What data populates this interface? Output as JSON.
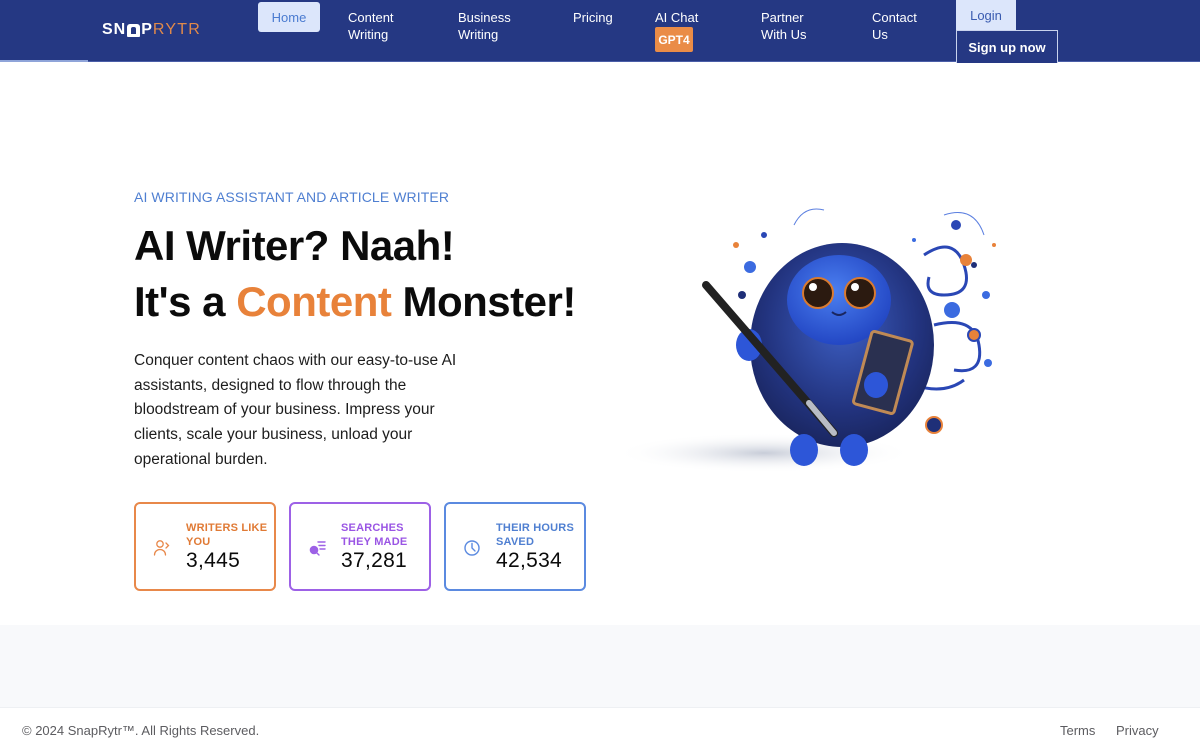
{
  "brand": {
    "name_part1": "SN",
    "name_part2": "P",
    "name_part3": "RYTR",
    "accent_color": "#e8823a",
    "primary_color": "#253883"
  },
  "nav": {
    "home": "Home",
    "content_writing": "Content Writing",
    "business_writing": "Business Writing",
    "pricing": "Pricing",
    "ai_chat": "AI Chat",
    "ai_chat_badge": "GPT4",
    "partner": "Partner With Us",
    "contact": "Contact Us",
    "login": "Login",
    "signup": "Sign up now"
  },
  "hero": {
    "eyebrow": "AI WRITING ASSISTANT AND ARTICLE WRITER",
    "headline_line1": "AI Writer? Naah!",
    "headline_line2_pre": "It's a ",
    "headline_line2_accent": "Content",
    "headline_line2_post": " Monster!",
    "description": "Conquer content chaos with our easy-to-use AI assistants, designed to flow through the bloodstream of your business. Impress your clients, scale your business, unload your operational burden.",
    "illustration": "blue-furry-monster-holding-pen-and-notebook"
  },
  "stats": [
    {
      "icon": "users-icon",
      "label": "WRITERS LIKE YOU",
      "value": "3,445",
      "color": "#e8884a"
    },
    {
      "icon": "search-list-icon",
      "label": "SEARCHES THEY MADE",
      "value": "37,281",
      "color": "#9d61e6"
    },
    {
      "icon": "clock-icon",
      "label": "THEIR HOURS SAVED",
      "value": "42,534",
      "color": "#5b8ae0"
    }
  ],
  "footer": {
    "copyright": "© 2024 SnapRytr™. All Rights Reserved.",
    "terms": "Terms",
    "privacy": "Privacy"
  }
}
